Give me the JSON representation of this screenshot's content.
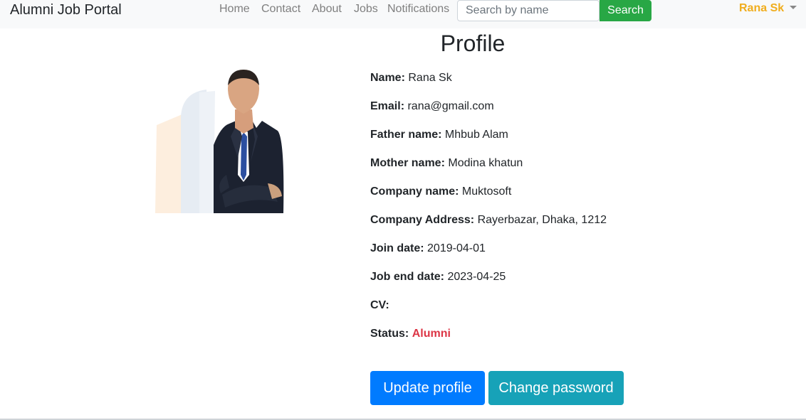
{
  "navbar": {
    "brand": "Alumni Job Portal",
    "links": [
      "Home",
      "Contact",
      "About",
      "Jobs",
      "Notifications"
    ],
    "search": {
      "placeholder": "Search by name",
      "value": "",
      "button_label": "Search"
    },
    "user": {
      "name": "Rana Sk",
      "icon": "caret-down-icon"
    }
  },
  "profile": {
    "title": "Profile",
    "photo_icon": "profile-photo",
    "fields": [
      {
        "label": "Name:",
        "value": "Rana Sk"
      },
      {
        "label": "Email:",
        "value": "rana@gmail.com"
      },
      {
        "label": "Father name:",
        "value": "Mhbub Alam"
      },
      {
        "label": "Mother name:",
        "value": "Modina khatun"
      },
      {
        "label": "Company name:",
        "value": "Muktosoft"
      },
      {
        "label": "Company Address:",
        "value": "Rayerbazar, Dhaka, 1212"
      },
      {
        "label": "Join date:",
        "value": "2019-04-01"
      },
      {
        "label": "Job end date:",
        "value": "2023-04-25"
      },
      {
        "label": "CV:",
        "value": ""
      },
      {
        "label": "Status:",
        "value": "Alumni"
      }
    ],
    "status_color": "#dc3545"
  },
  "actions": {
    "update_label": "Update profile",
    "password_label": "Change password"
  },
  "colors": {
    "primary": "#007bff",
    "info": "#17a2b8",
    "success": "#28a745",
    "user_accent": "#f0ad1d"
  }
}
